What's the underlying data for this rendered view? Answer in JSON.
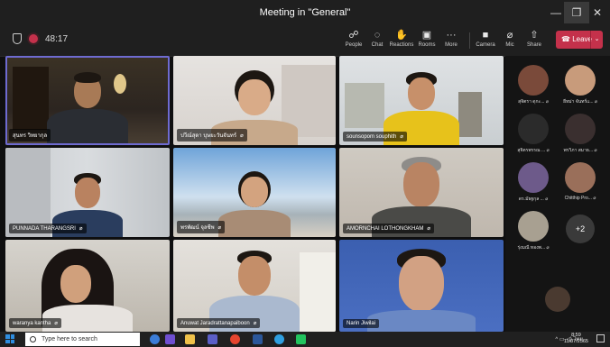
{
  "window": {
    "title": "Meeting in \"General\"",
    "minimize_glyph": "—",
    "maximize_glyph": "❐",
    "close_glyph": "✕"
  },
  "toolbar": {
    "timer": "48:17",
    "people": "People",
    "chat": "Chat",
    "reactions": "Reactions",
    "rooms": "Rooms",
    "more": "More",
    "camera": "Camera",
    "mic": "Mic",
    "share": "Share",
    "leave": "Leave"
  },
  "participants": [
    {
      "name": "สุนทร วิทยากุล"
    },
    {
      "name": "ปวีณ์สุดา บุษยะวันจันทร์"
    },
    {
      "name": "sounsopom souphith"
    },
    {
      "name": "PUNNADA THARANGSRI"
    },
    {
      "name": "พรพัฒน์ จุลชีพ"
    },
    {
      "name": "AMORNCHAI LOTHONGKHAM"
    },
    {
      "name": "waranya kantha"
    },
    {
      "name": "Anuwat Jaradrattanapaiboon"
    },
    {
      "name": "Narin Jiwilai"
    }
  ],
  "sidebar": {
    "people": [
      {
        "label": "สุจิตรา ดุกะ..."
      },
      {
        "label": "ยีหม่า จันทร์แ..."
      },
      {
        "label": "สุจิตรพรรณ ..."
      },
      {
        "label": "พรวิภา สมาธ..."
      },
      {
        "label": "ดร.มัธฐกุล ..."
      },
      {
        "label": "Chitthip Pro..."
      },
      {
        "label": "รุ่งมณี ทองพ..."
      }
    ],
    "more_count": "+2"
  },
  "taskbar": {
    "search_placeholder": "Type here to search",
    "language": "ไทย",
    "time": "8:59",
    "date": "11/07/2565"
  },
  "colors": {
    "leave_red": "#c4314b",
    "start_blue": "#2f8ee0",
    "bg": "#0f0f10"
  }
}
